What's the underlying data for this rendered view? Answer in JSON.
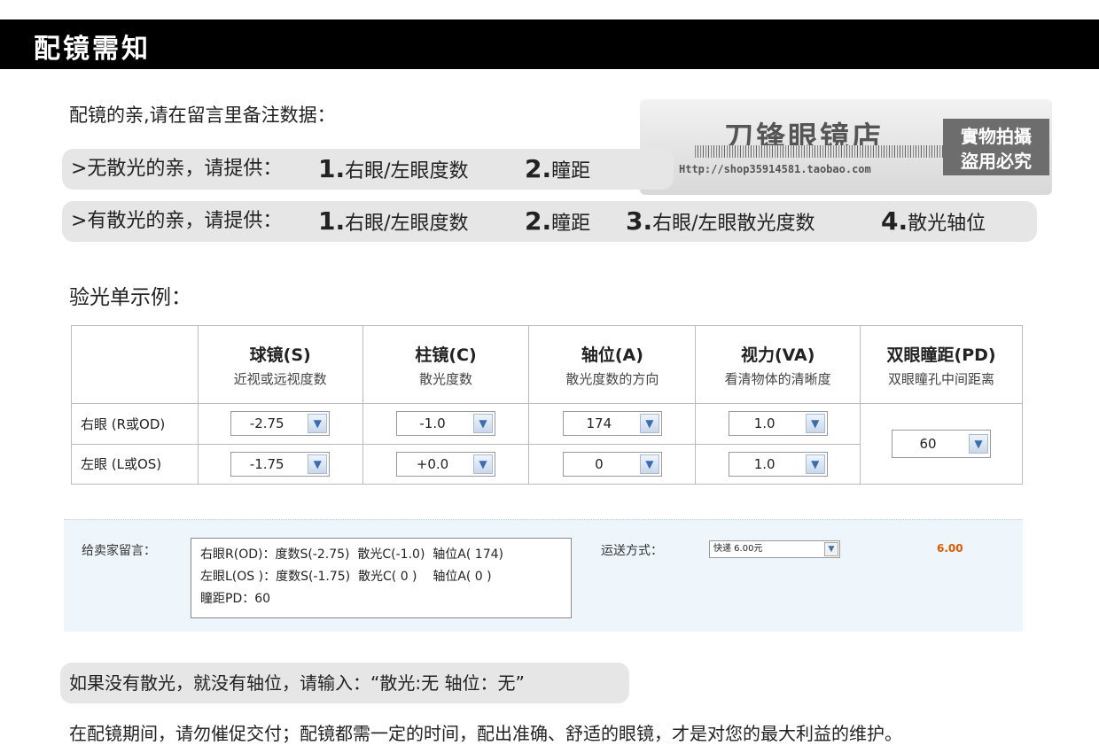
{
  "header": {
    "title": "配镜需知"
  },
  "intro": "配镜的亲,请在留言里备注数据：",
  "no_astig": {
    "prefix": ">无散光的亲，请提供：",
    "items": [
      {
        "num": "1.",
        "text": "右眼/左眼度数"
      },
      {
        "num": "2.",
        "text": "瞳距"
      }
    ]
  },
  "with_astig": {
    "prefix": ">有散光的亲，请提供：",
    "items": [
      {
        "num": "1.",
        "text": "右眼/左眼度数"
      },
      {
        "num": "2.",
        "text": "瞳距"
      },
      {
        "num": "3.",
        "text": "右眼/左眼散光度数"
      },
      {
        "num": "4.",
        "text": "散光轴位"
      }
    ]
  },
  "watermark": {
    "shop": "刀锋眼镜店",
    "url": "Http://shop35914581.taobao.com",
    "badge_line1": "實物拍攝",
    "badge_line2": "盜用必究"
  },
  "example_title": "验光单示例：",
  "rx_table": {
    "columns": [
      {
        "title": "球镜(S)",
        "sub": "近视或远视度数"
      },
      {
        "title": "柱镜(C)",
        "sub": "散光度数"
      },
      {
        "title": "轴位(A)",
        "sub": "散光度数的方向"
      },
      {
        "title": "视力(VA)",
        "sub": "看清物体的清晰度"
      },
      {
        "title": "双眼瞳距(PD)",
        "sub": "双眼瞳孔中间距离"
      }
    ],
    "rows": [
      {
        "label": "右眼 (R或OD)",
        "values": [
          "-2.75",
          "-1.0",
          "174",
          "1.0"
        ]
      },
      {
        "label": "左眼 (L或OS)",
        "values": [
          "-1.75",
          "+0.0",
          "0",
          "1.0"
        ]
      }
    ],
    "pd": "60"
  },
  "order": {
    "msg_label": "给卖家留言：",
    "msg_lines": [
      "右眼R(OD)：度数S(-2.75)  散光C(-1.0)  轴位A( 174)",
      "左眼L(OS )：度数S(-1.75)  散光C( 0 )    轴位A( 0 )",
      "瞳距PD：60"
    ],
    "ship_label": "运送方式：",
    "ship_value": "快递 6.00元",
    "price": "6.00",
    "colors": {
      "price": "#e05a00"
    }
  },
  "note": "如果没有散光，就没有轴位，请输入：“散光:无    轴位：无”",
  "footer": "在配镜期间，请勿催促交付；配镜都需一定的时间，配出准确、舒适的眼镜，才是对您的最大利益的维护。"
}
